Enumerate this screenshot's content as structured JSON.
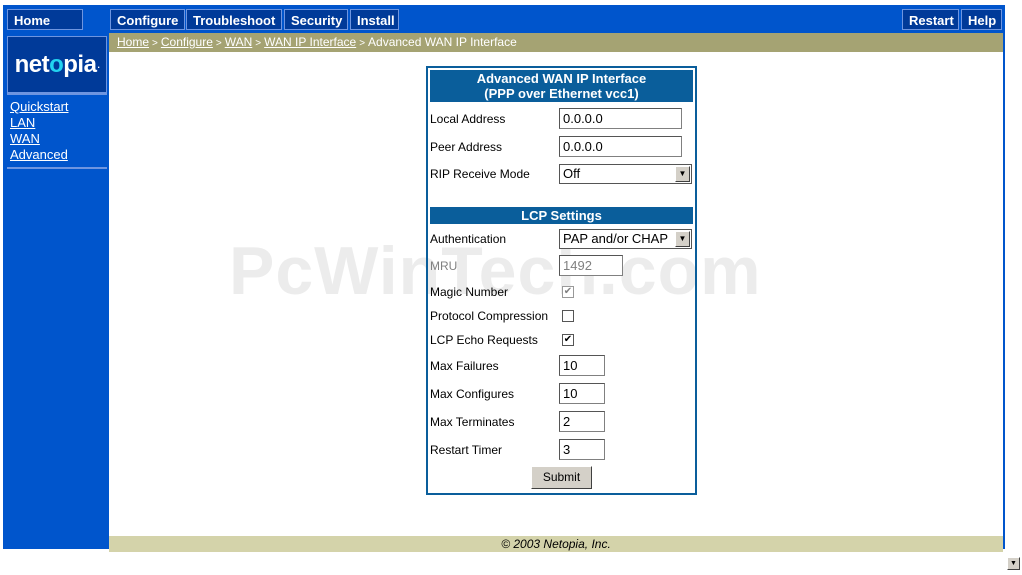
{
  "nav": {
    "home": "Home",
    "configure": "Configure",
    "troubleshoot": "Troubleshoot",
    "security": "Security",
    "install": "Install",
    "restart": "Restart",
    "help": "Help"
  },
  "logo": {
    "pre": "net",
    "dot": "o",
    "post": "pia",
    "reg": "."
  },
  "sidebar": {
    "links": [
      "Quickstart",
      "LAN",
      "WAN",
      "Advanced"
    ]
  },
  "breadcrumb": {
    "items": [
      "Home",
      "Configure",
      "WAN",
      "WAN IP Interface"
    ],
    "current": "Advanced WAN IP Interface",
    "sep": ">"
  },
  "form": {
    "title_line1": "Advanced WAN IP Interface",
    "title_line2": "(PPP over Ethernet vcc1)",
    "local_address_label": "Local Address",
    "local_address_value": "0.0.0.0",
    "peer_address_label": "Peer Address",
    "peer_address_value": "0.0.0.0",
    "rip_label": "RIP Receive Mode",
    "rip_value": "Off",
    "lcp_title": "LCP Settings",
    "auth_label": "Authentication",
    "auth_value": "PAP and/or CHAP",
    "mru_label": "MRU",
    "mru_value": "1492",
    "magic_label": "Magic Number",
    "magic_mark": "✔",
    "protocol_label": "Protocol Compression",
    "protocol_mark": "",
    "lcp_echo_label": "LCP Echo Requests",
    "lcp_echo_mark": "✔",
    "max_failures_label": "Max Failures",
    "max_failures_value": "10",
    "max_configures_label": "Max Configures",
    "max_configures_value": "10",
    "max_terminates_label": "Max Terminates",
    "max_terminates_value": "2",
    "restart_timer_label": "Restart Timer",
    "restart_timer_value": "3",
    "submit_label": "Submit"
  },
  "footer": {
    "copyright": "© 2003 Netopia, Inc."
  },
  "watermark": "PcWinTech.com"
}
